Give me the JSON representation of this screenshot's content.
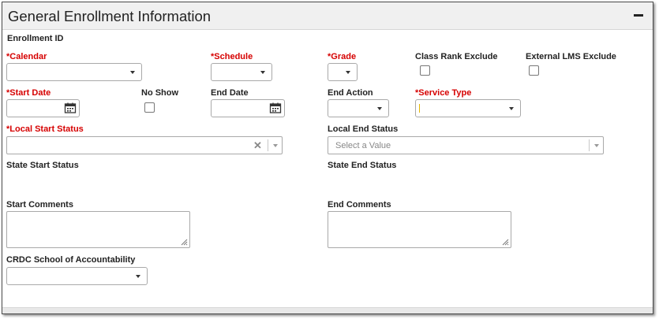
{
  "panel": {
    "title": "General Enrollment Information"
  },
  "fields": {
    "enrollment_id": {
      "label": "Enrollment ID"
    },
    "calendar": {
      "required_mark": "*",
      "label": "Calendar",
      "value": ""
    },
    "schedule": {
      "required_mark": "*",
      "label": "Schedule",
      "value": ""
    },
    "grade": {
      "required_mark": "*",
      "label": "Grade",
      "value": ""
    },
    "class_rank_exclude": {
      "label": "Class Rank Exclude",
      "checked": false
    },
    "external_lms_exclude": {
      "label": "External LMS Exclude",
      "checked": false
    },
    "start_date": {
      "required_mark": "*",
      "label": "Start Date",
      "value": ""
    },
    "no_show": {
      "label": "No Show",
      "checked": false
    },
    "end_date": {
      "label": "End Date",
      "value": ""
    },
    "end_action": {
      "label": "End Action",
      "value": ""
    },
    "service_type": {
      "required_mark": "*",
      "label": "Service Type",
      "value": ""
    },
    "local_start_status": {
      "required_mark": "*",
      "label": "Local Start Status",
      "value": ""
    },
    "local_end_status": {
      "label": "Local End Status",
      "placeholder": "Select a Value"
    },
    "state_start_status": {
      "label": "State Start Status"
    },
    "state_end_status": {
      "label": "State End Status"
    },
    "start_comments": {
      "label": "Start Comments",
      "value": ""
    },
    "end_comments": {
      "label": "End Comments",
      "value": ""
    },
    "crdc_school": {
      "label": "CRDC School of Accountability",
      "value": ""
    }
  },
  "icons": {
    "collapse": "minus-icon",
    "calendar": "calendar-icon",
    "dropdown": "chevron-down-icon",
    "clear": "close-icon",
    "resize": "resize-grip-icon"
  },
  "colors": {
    "required": "#d60000",
    "header_bg": "#f0f0f0",
    "border": "#a9a9a9"
  }
}
